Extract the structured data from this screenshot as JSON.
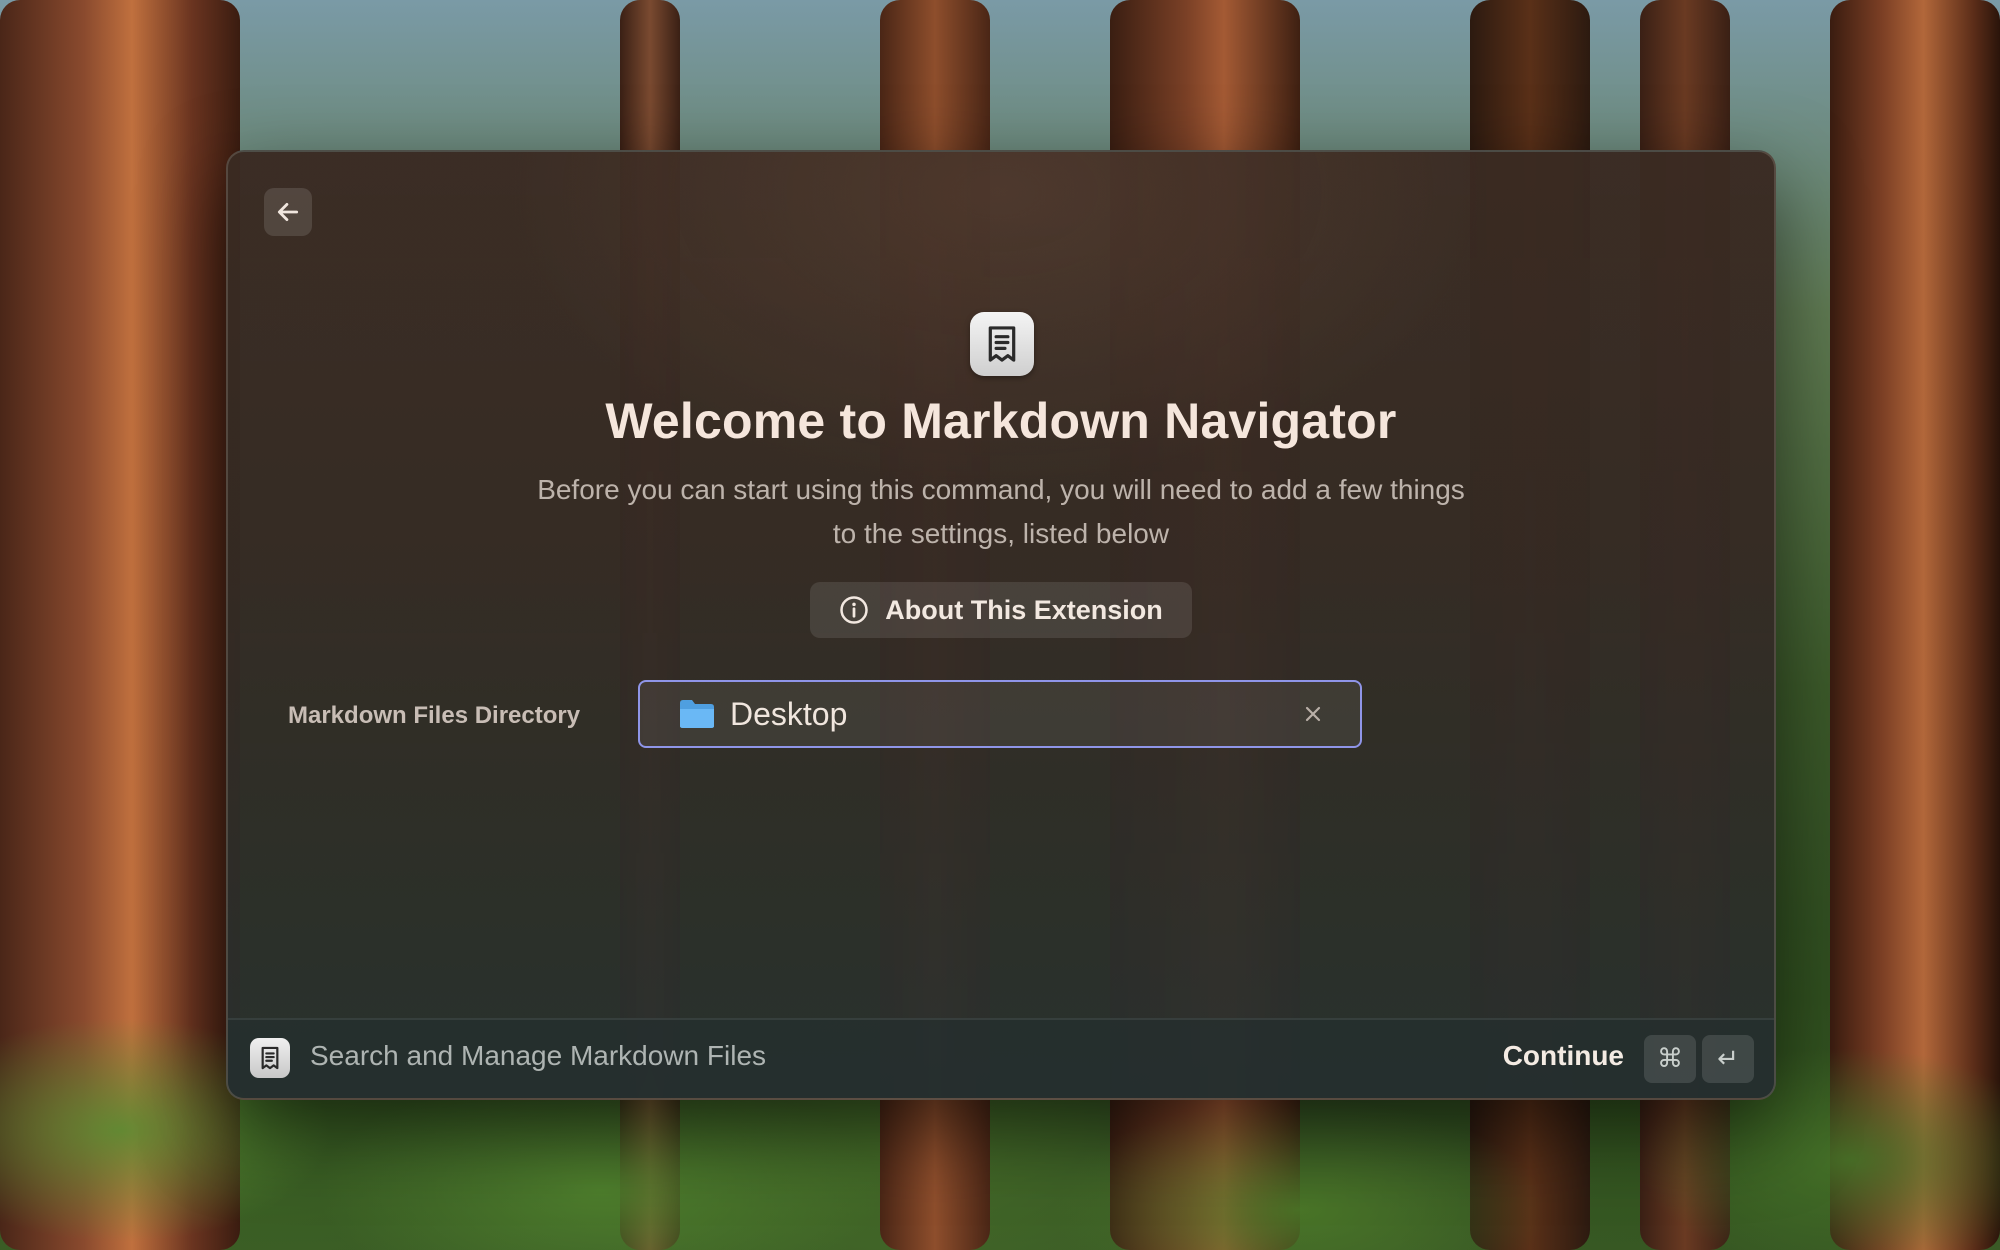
{
  "window": {
    "back_button_label": "Back"
  },
  "welcome": {
    "title": "Welcome to Markdown Navigator",
    "subtitle": "Before you can start using this command, you will need to add a few things to the settings, listed below",
    "about_button_label": "About This Extension"
  },
  "settings": {
    "directory_label": "Markdown Files Directory",
    "directory_value": "Desktop"
  },
  "footer": {
    "command_title": "Search and Manage Markdown Files",
    "primary_action_label": "Continue",
    "shortcut_keys": [
      "⌘",
      "↵"
    ]
  },
  "icons": {
    "back": "arrow-left-icon",
    "extension": "document-icon",
    "about": "info-icon",
    "folder": "folder-icon",
    "clear": "close-icon"
  },
  "colors": {
    "accent_focus_border": "#8f95e8",
    "folder_blue": "#5fb2f2",
    "title_text": "#f5e6dc"
  }
}
